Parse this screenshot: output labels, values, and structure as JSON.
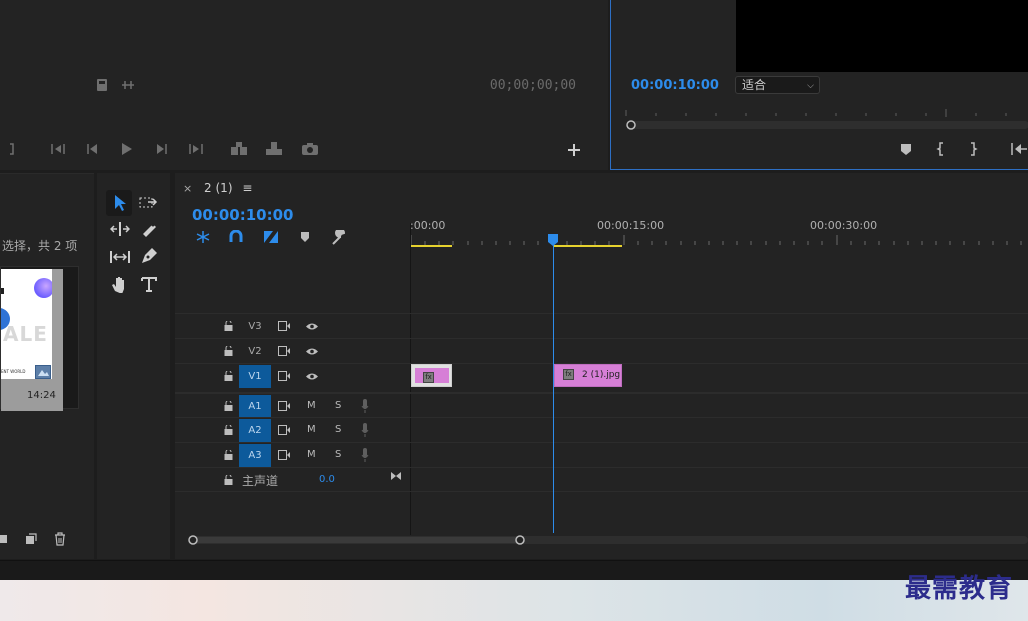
{
  "source_monitor": {
    "timecode": "00;00;00;00"
  },
  "program_monitor": {
    "timecode": "00:00:10:00",
    "fit_select": "适合"
  },
  "project": {
    "selection_text": "选择，共 2 项",
    "thumb_duration": "14:24",
    "thumb_text_large": "ALE",
    "thumb_text_small": "ENT WORLD"
  },
  "timeline": {
    "sequence_tab": "2 (1)",
    "timecode": "00:00:10:00",
    "ruler_labels": [
      ":00:00",
      "00:00:15:00",
      "00:00:30:00"
    ],
    "tracks": {
      "v3": "V3",
      "v2": "V2",
      "v1": "V1",
      "a1": "A1",
      "a2": "A2",
      "a3": "A3",
      "master_label": "主声道",
      "master_value": "0.0",
      "mute": "M",
      "solo": "S"
    },
    "clips": {
      "clip2_name": "2 (1).jpg",
      "fx": "fx"
    }
  },
  "watermark": "最需教育",
  "colors": {
    "accent_blue": "#2d8ceb",
    "track_on": "#0d5a9b",
    "clip_pink": "#d67fd6",
    "panel_bg": "#232323"
  }
}
